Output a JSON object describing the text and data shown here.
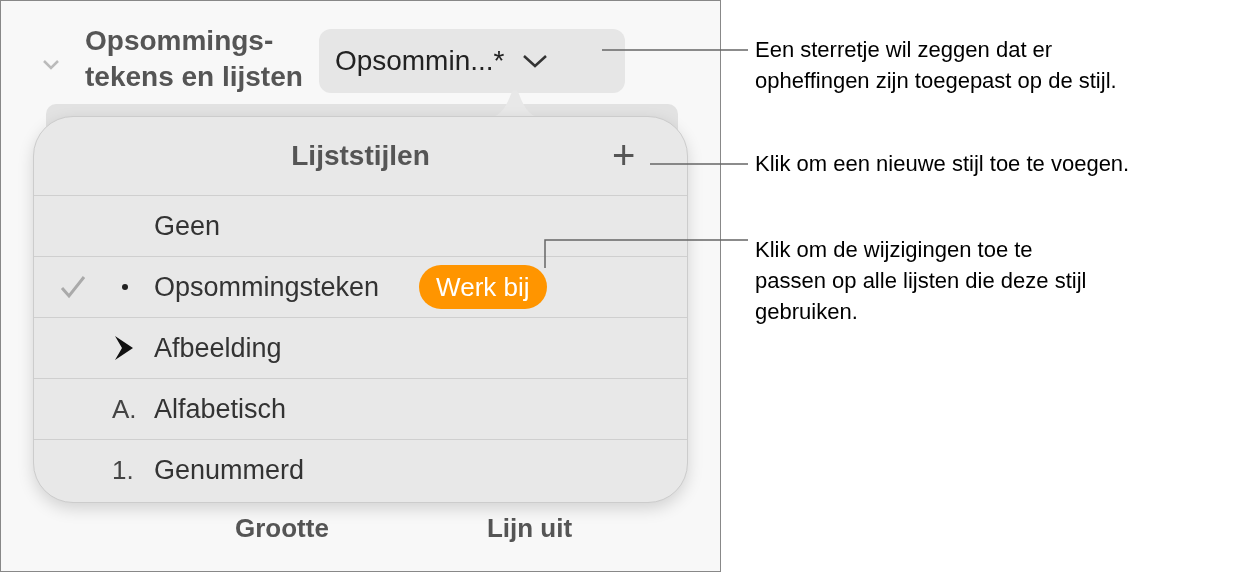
{
  "section": {
    "title": "Opsommings-\ntekens en lijsten",
    "expanded": true,
    "style_menu": {
      "value": "Opsommin...*"
    }
  },
  "popover": {
    "title": "Lijststijlen",
    "add_button": "+",
    "styles": [
      {
        "label": "Geen",
        "kind": "none",
        "selected": false
      },
      {
        "label": "Opsommingsteken",
        "kind": "bullet",
        "selected": true,
        "update_button": "Werk bij"
      },
      {
        "label": "Afbeelding",
        "kind": "image",
        "selected": false
      },
      {
        "label": "Alfabetisch",
        "kind": "text",
        "marker": "A.",
        "selected": false
      },
      {
        "label": "Genummerd",
        "kind": "text",
        "marker": "1.",
        "selected": false
      }
    ]
  },
  "bottom_labels": [
    "Grootte",
    "Lijn uit"
  ],
  "callouts": [
    {
      "text": "Een sterretje wil zeggen dat er\nopheffingen zijn toegepast op de stijl."
    },
    {
      "text": "Klik om een nieuwe stijl toe te voegen."
    },
    {
      "text": "Klik om de wijzigingen toe te\npassen op alle lijsten die deze stijl\ngebruiken."
    }
  ]
}
